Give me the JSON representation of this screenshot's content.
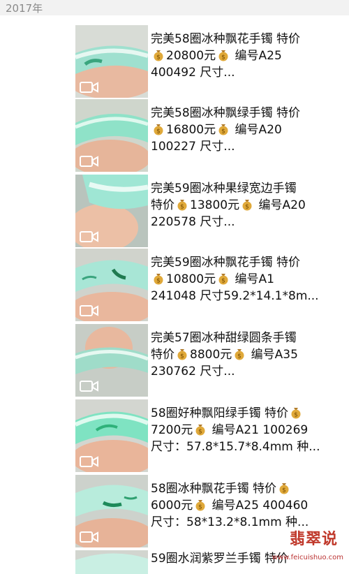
{
  "header": {
    "year": "2017年"
  },
  "posts": [
    {
      "line1": "完美58圈冰种飘花手镯 特价",
      "price": "20800元",
      "line2rest": "编号A25",
      "line3": "400492 尺寸..."
    },
    {
      "line1": "完美58圈冰种飘绿手镯 特价",
      "price": "16800元",
      "line2rest": "编号A20",
      "line3": "100227 尺寸..."
    },
    {
      "line1": "完美59圈冰种果绿宽边手镯",
      "line2pre": "特价",
      "price": "13800元",
      "line2rest": "编号A20",
      "line3": "220578 尺寸..."
    },
    {
      "line1": "完美59圈冰种飘花手镯 特价",
      "price": "10800元",
      "line2rest": "编号A1",
      "line3": "241048 尺寸59.2*14.1*8m..."
    },
    {
      "line1": "完美57圈冰种甜绿圆条手镯",
      "line2pre": "特价",
      "price": "8800元",
      "line2rest": "编号A35",
      "line3": "230762 尺寸..."
    },
    {
      "line1": "58圈好种飘阳绿手镯 特价",
      "price": "7200元",
      "line2rest": "编号A21 100269",
      "line3": "尺寸：57.8*15.7*8.4mm 种..."
    },
    {
      "line1": "58圈冰种飘花手镯 特价",
      "price": "6000元",
      "line2rest": "编号A25 400460",
      "line3": "尺寸：58*13.2*8.1mm 种..."
    },
    {
      "line1": "59圈水润紫罗兰手镯 特价"
    }
  ],
  "watermark": {
    "brand": "翡翠说",
    "url": "www.feicuishuo.com"
  },
  "colors": {
    "bg": "#ffffff",
    "year_bar": "#f2f2f2",
    "text": "#111111",
    "jade": "#7fd3c4"
  }
}
